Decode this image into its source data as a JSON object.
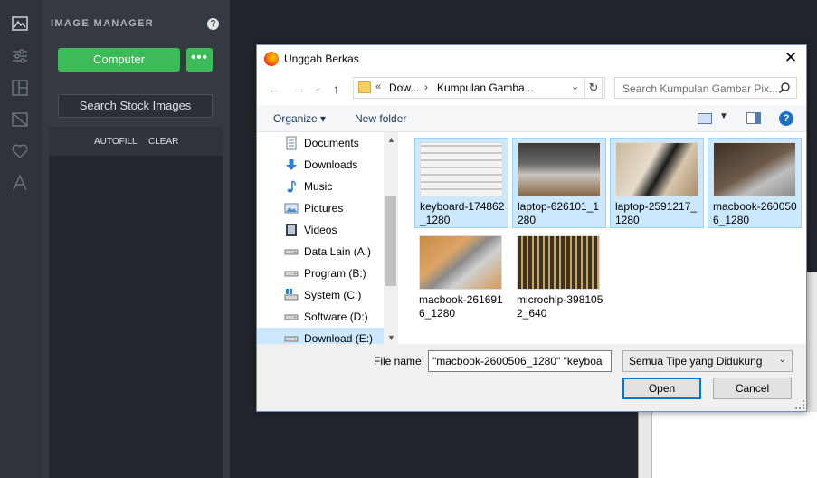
{
  "sidebar_panel": {
    "title": "IMAGE MANAGER",
    "help_icon": "?",
    "computer_label": "Computer",
    "more_label": "•••",
    "search_stock_label": "Search Stock Images",
    "autofill_label": "AUTOFILL",
    "clear_label": "CLEAR"
  },
  "rail_icons": [
    "image-chart-icon",
    "sliders-icon",
    "layout-icon",
    "image-crossed-icon",
    "heart-icon",
    "text-icon"
  ],
  "dialog": {
    "title": "Unggah Berkas",
    "close": "✕",
    "address": {
      "chevrons": "«",
      "crumb1": "Dow...",
      "separator": "›",
      "crumb2": "Kumpulan Gamba..."
    },
    "search_placeholder": "Search Kumpulan Gambar Pix...",
    "toolbar": {
      "organize": "Organize ▾",
      "new_folder": "New folder"
    },
    "nav_items": [
      {
        "label": "Documents",
        "icon": "documents-icon"
      },
      {
        "label": "Downloads",
        "icon": "downloads-icon"
      },
      {
        "label": "Music",
        "icon": "music-icon"
      },
      {
        "label": "Pictures",
        "icon": "pictures-icon"
      },
      {
        "label": "Videos",
        "icon": "videos-icon"
      },
      {
        "label": "Data Lain (A:)",
        "icon": "drive-icon"
      },
      {
        "label": "Program (B:)",
        "icon": "drive-icon"
      },
      {
        "label": "System (C:)",
        "icon": "windows-drive-icon"
      },
      {
        "label": "Software (D:)",
        "icon": "drive-icon"
      },
      {
        "label": "Download (E:)",
        "icon": "drive-icon"
      }
    ],
    "files": [
      {
        "name": "keyboard-174862_1280",
        "selected": true
      },
      {
        "name": "laptop-626101_1280",
        "selected": true
      },
      {
        "name": "laptop-2591217_1280",
        "selected": true
      },
      {
        "name": "macbook-2600506_1280",
        "selected": true
      },
      {
        "name": "macbook-2616916_1280",
        "selected": false
      },
      {
        "name": "microchip-3981052_640",
        "selected": false
      }
    ],
    "filename_label": "File name:",
    "filename_value": "\"macbook-2600506_1280\" \"keyboa",
    "filetype": "Semua Tipe yang Didukung",
    "open_label": "Open",
    "cancel_label": "Cancel"
  }
}
